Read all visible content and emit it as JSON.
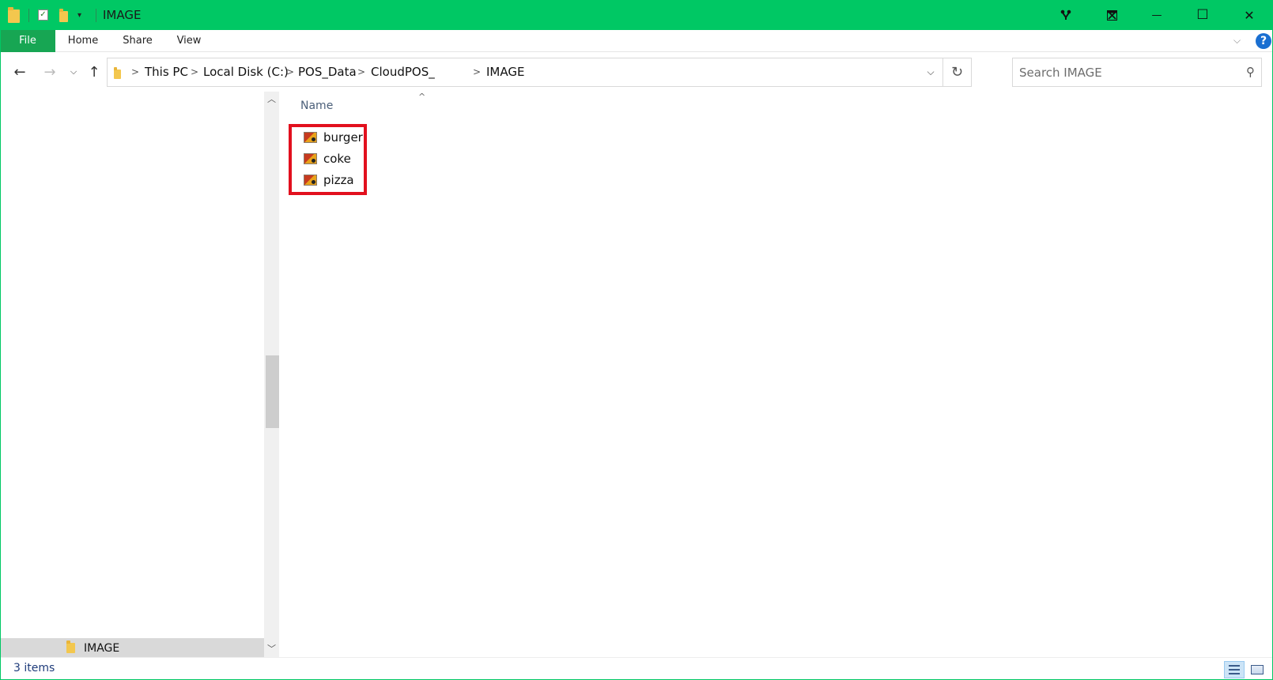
{
  "window": {
    "title": "IMAGE",
    "accent_color": "#00c864",
    "controls": {
      "extra1_icon": "fork-icon",
      "extra2_icon": "grid-icon",
      "minimize": "—",
      "maximize": "☐",
      "close": "✕"
    }
  },
  "quick_access": {
    "qat_icons": [
      "folder-icon",
      "properties-check-icon",
      "new-folder-icon",
      "customize-dropdown-icon"
    ]
  },
  "ribbon": {
    "tabs": [
      {
        "label": "File"
      },
      {
        "label": "Home"
      },
      {
        "label": "Share"
      },
      {
        "label": "View"
      }
    ],
    "help_label": "?"
  },
  "address_bar": {
    "breadcrumbs": [
      "This PC",
      "Local Disk (C:)",
      "POS_Data",
      "CloudPOS_",
      "IMAGE"
    ]
  },
  "search": {
    "placeholder": "Search IMAGE"
  },
  "nav_pane": {
    "selected_item": "IMAGE"
  },
  "content": {
    "column_header": "Name",
    "files": [
      {
        "name": "burger",
        "icon": "image-file-icon"
      },
      {
        "name": "coke",
        "icon": "image-file-icon"
      },
      {
        "name": "pizza",
        "icon": "image-file-icon"
      }
    ],
    "highlight_color": "#e2101e"
  },
  "status_bar": {
    "item_count": "3 items"
  }
}
